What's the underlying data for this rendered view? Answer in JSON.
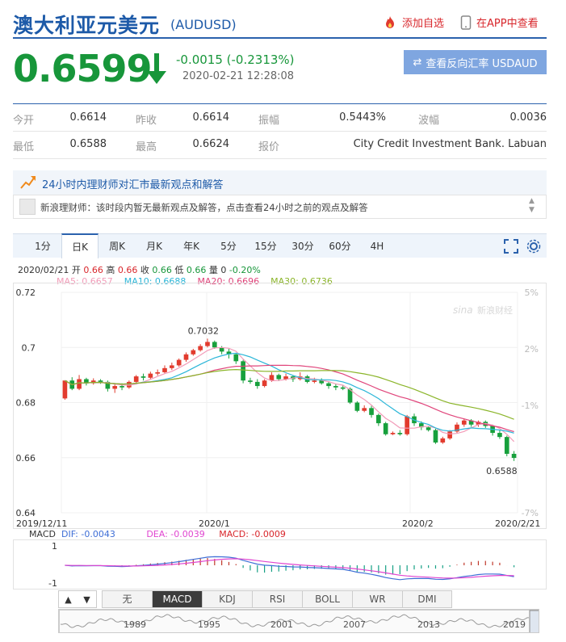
{
  "header": {
    "title": "澳大利亚元美元",
    "code": "(AUDUSD)",
    "add_fav": "添加自选",
    "view_app": "在APP中查看",
    "price": "0.6599",
    "change": "-0.0015 (-0.2313%)",
    "time": "2020-02-21 12:28:08",
    "inverse_btn": "查看反向汇率 USDAUD",
    "colors": {
      "brand": "#1d5aa8",
      "down": "#17963a",
      "up": "#d8262b"
    }
  },
  "quote": {
    "open_label": "今开",
    "open": "0.6614",
    "prev_close_label": "昨收",
    "prev_close": "0.6614",
    "amplitude_label": "振幅",
    "amplitude": "0.5443%",
    "wave_label": "波幅",
    "wave": "0.0036",
    "low_label": "最低",
    "low": "0.6588",
    "high_label": "最高",
    "high": "0.6624",
    "quote_by_label": "报价",
    "quote_by": "City Credit Investment Bank. Labuan"
  },
  "advisor": {
    "title": "24小时内理财师对汇市最新观点和解答",
    "text": "新浪理财师：该时段内暂无最新观点及解答，点击查看24小时之前的观点及解答"
  },
  "tabs": [
    "1分",
    "日K",
    "周K",
    "月K",
    "年K",
    "5分",
    "15分",
    "30分",
    "60分",
    "4H"
  ],
  "active_tab": "日K",
  "legend": {
    "date": "2020/02/21",
    "open_l": "开",
    "open": "0.66",
    "high_l": "高",
    "high": "0.66",
    "close_l": "收",
    "close": "0.66",
    "low_l": "低",
    "low": "0.66",
    "vol_l": "量",
    "vol": "0",
    "pct": "-0.20%",
    "ma5": "MA5: 0.6657",
    "ma10": "MA10: 0.6688",
    "ma20": "MA20: 0.6696",
    "ma30": "MA30: 0.6736"
  },
  "watermark": "新浪财经",
  "chart_data": {
    "type": "candlestick",
    "y_axis_left": [
      "0.72",
      "0.7",
      "0.68",
      "0.66",
      "0.64"
    ],
    "y_axis_right": [
      "5%",
      "2%",
      "-1%",
      "-7%"
    ],
    "x_axis": [
      "2019/12/11",
      "2020/1",
      "2020/2",
      "2020/2/21"
    ],
    "ylim": [
      0.64,
      0.72
    ],
    "high_label": "0.7032",
    "low_label": "0.6588",
    "candles": [
      [
        0.6815,
        0.688,
        0.6875,
        0.681
      ],
      [
        0.688,
        0.685,
        0.6892,
        0.6845
      ],
      [
        0.685,
        0.6885,
        0.69,
        0.6845
      ],
      [
        0.6885,
        0.687,
        0.689,
        0.6862
      ],
      [
        0.687,
        0.688,
        0.6888,
        0.6865
      ],
      [
        0.688,
        0.6875,
        0.6885,
        0.6868
      ],
      [
        0.6875,
        0.685,
        0.688,
        0.684
      ],
      [
        0.685,
        0.686,
        0.687,
        0.6835
      ],
      [
        0.686,
        0.6855,
        0.687,
        0.6845
      ],
      [
        0.6855,
        0.6875,
        0.688,
        0.685
      ],
      [
        0.6875,
        0.6895,
        0.69,
        0.687
      ],
      [
        0.6895,
        0.689,
        0.6905,
        0.688
      ],
      [
        0.689,
        0.6905,
        0.6912,
        0.6885
      ],
      [
        0.6905,
        0.691,
        0.692,
        0.6898
      ],
      [
        0.691,
        0.6925,
        0.6935,
        0.6905
      ],
      [
        0.6925,
        0.6935,
        0.6945,
        0.6918
      ],
      [
        0.6935,
        0.6955,
        0.696,
        0.693
      ],
      [
        0.6955,
        0.6975,
        0.6982,
        0.6948
      ],
      [
        0.6975,
        0.699,
        0.6995,
        0.697
      ],
      [
        0.699,
        0.7005,
        0.7012,
        0.6985
      ],
      [
        0.7005,
        0.702,
        0.7032,
        0.7
      ],
      [
        0.702,
        0.7,
        0.7025,
        0.6995
      ],
      [
        0.7,
        0.6985,
        0.7005,
        0.6975
      ],
      [
        0.6985,
        0.6975,
        0.6995,
        0.696
      ],
      [
        0.6975,
        0.695,
        0.698,
        0.694
      ],
      [
        0.695,
        0.688,
        0.6955,
        0.687
      ],
      [
        0.688,
        0.6875,
        0.689,
        0.6868
      ],
      [
        0.6875,
        0.686,
        0.6885,
        0.685
      ],
      [
        0.686,
        0.688,
        0.6885,
        0.6855
      ],
      [
        0.688,
        0.69,
        0.691,
        0.6875
      ],
      [
        0.69,
        0.6885,
        0.6905,
        0.6878
      ],
      [
        0.6885,
        0.6895,
        0.6905,
        0.688
      ],
      [
        0.6895,
        0.6885,
        0.69,
        0.6875
      ],
      [
        0.6885,
        0.6895,
        0.691,
        0.688
      ],
      [
        0.6895,
        0.6875,
        0.69,
        0.687
      ],
      [
        0.6875,
        0.688,
        0.689,
        0.687
      ],
      [
        0.688,
        0.687,
        0.6888,
        0.6865
      ],
      [
        0.687,
        0.686,
        0.6878,
        0.685
      ],
      [
        0.686,
        0.6855,
        0.6868,
        0.6845
      ],
      [
        0.6855,
        0.685,
        0.6862,
        0.6845
      ],
      [
        0.685,
        0.68,
        0.6855,
        0.6795
      ],
      [
        0.68,
        0.677,
        0.6805,
        0.6765
      ],
      [
        0.677,
        0.678,
        0.679,
        0.6765
      ],
      [
        0.678,
        0.6755,
        0.6788,
        0.6745
      ],
      [
        0.6755,
        0.6725,
        0.676,
        0.6715
      ],
      [
        0.6725,
        0.6685,
        0.673,
        0.668
      ],
      [
        0.6685,
        0.669,
        0.6695,
        0.6682
      ],
      [
        0.669,
        0.6685,
        0.67,
        0.668
      ],
      [
        0.6685,
        0.675,
        0.6755,
        0.668
      ],
      [
        0.675,
        0.6725,
        0.676,
        0.6715
      ],
      [
        0.6725,
        0.671,
        0.6732,
        0.67
      ],
      [
        0.671,
        0.67,
        0.6715,
        0.6695
      ],
      [
        0.67,
        0.6655,
        0.6705,
        0.665
      ],
      [
        0.6655,
        0.667,
        0.6676,
        0.665
      ],
      [
        0.667,
        0.6695,
        0.67,
        0.6665
      ],
      [
        0.6695,
        0.672,
        0.6728,
        0.669
      ],
      [
        0.672,
        0.6735,
        0.6742,
        0.6712
      ],
      [
        0.6735,
        0.672,
        0.674,
        0.6712
      ],
      [
        0.672,
        0.673,
        0.6735,
        0.6712
      ],
      [
        0.673,
        0.6715,
        0.6735,
        0.6708
      ],
      [
        0.6715,
        0.669,
        0.672,
        0.668
      ],
      [
        0.669,
        0.6675,
        0.67,
        0.6668
      ],
      [
        0.6675,
        0.6614,
        0.668,
        0.6605
      ],
      [
        0.6614,
        0.6599,
        0.6624,
        0.6588
      ]
    ],
    "macd_labels": {
      "name": "MACD",
      "dif": "DIF: -0.0043",
      "dea": "DEA: -0.0039",
      "macd": "MACD: -0.0009",
      "y_top": "1",
      "y_bottom": "-1"
    }
  },
  "indicator_tabs": [
    "无",
    "MACD",
    "KDJ",
    "RSI",
    "BOLL",
    "WR",
    "DMI"
  ],
  "active_indicator": "MACD",
  "nav_years": [
    "1989",
    "1995",
    "2001",
    "2007",
    "2013",
    "2019"
  ]
}
